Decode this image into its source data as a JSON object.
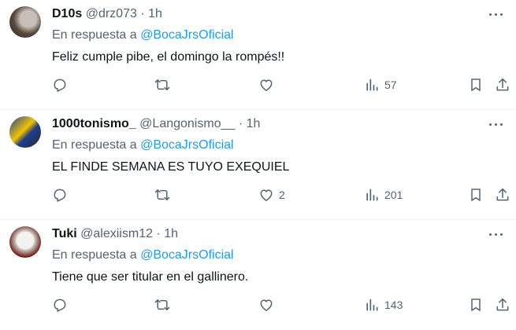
{
  "replies": [
    {
      "name": "D10s",
      "handle": "@drz073",
      "time": "1h",
      "reply_prefix": "En respuesta a",
      "reply_mention": "@BocaJrsOficial",
      "text": "Feliz cumple pibe, el domingo la rompés!!",
      "likes": "",
      "views": "57"
    },
    {
      "name": "1000tonismo_",
      "handle": "@Langonismo__",
      "time": "1h",
      "reply_prefix": "En respuesta a",
      "reply_mention": "@BocaJrsOficial",
      "text": "EL FINDE SEMANA ES TUYO EXEQUIEL",
      "likes": "2",
      "views": "201"
    },
    {
      "name": "Tuki",
      "handle": "@alexiism12",
      "time": "1h",
      "reply_prefix": "En respuesta a",
      "reply_mention": "@BocaJrsOficial",
      "text": "Tiene que ser titular en el gallinero.",
      "likes": "",
      "views": "143"
    }
  ],
  "separator": "·",
  "colors": {
    "link": "#1d9bf0",
    "muted": "#536471",
    "text": "#0f1419",
    "divider": "#eff3f4"
  },
  "icons": [
    "reply-icon",
    "retweet-icon",
    "like-icon",
    "views-icon",
    "bookmark-icon",
    "share-icon",
    "more-icon"
  ]
}
